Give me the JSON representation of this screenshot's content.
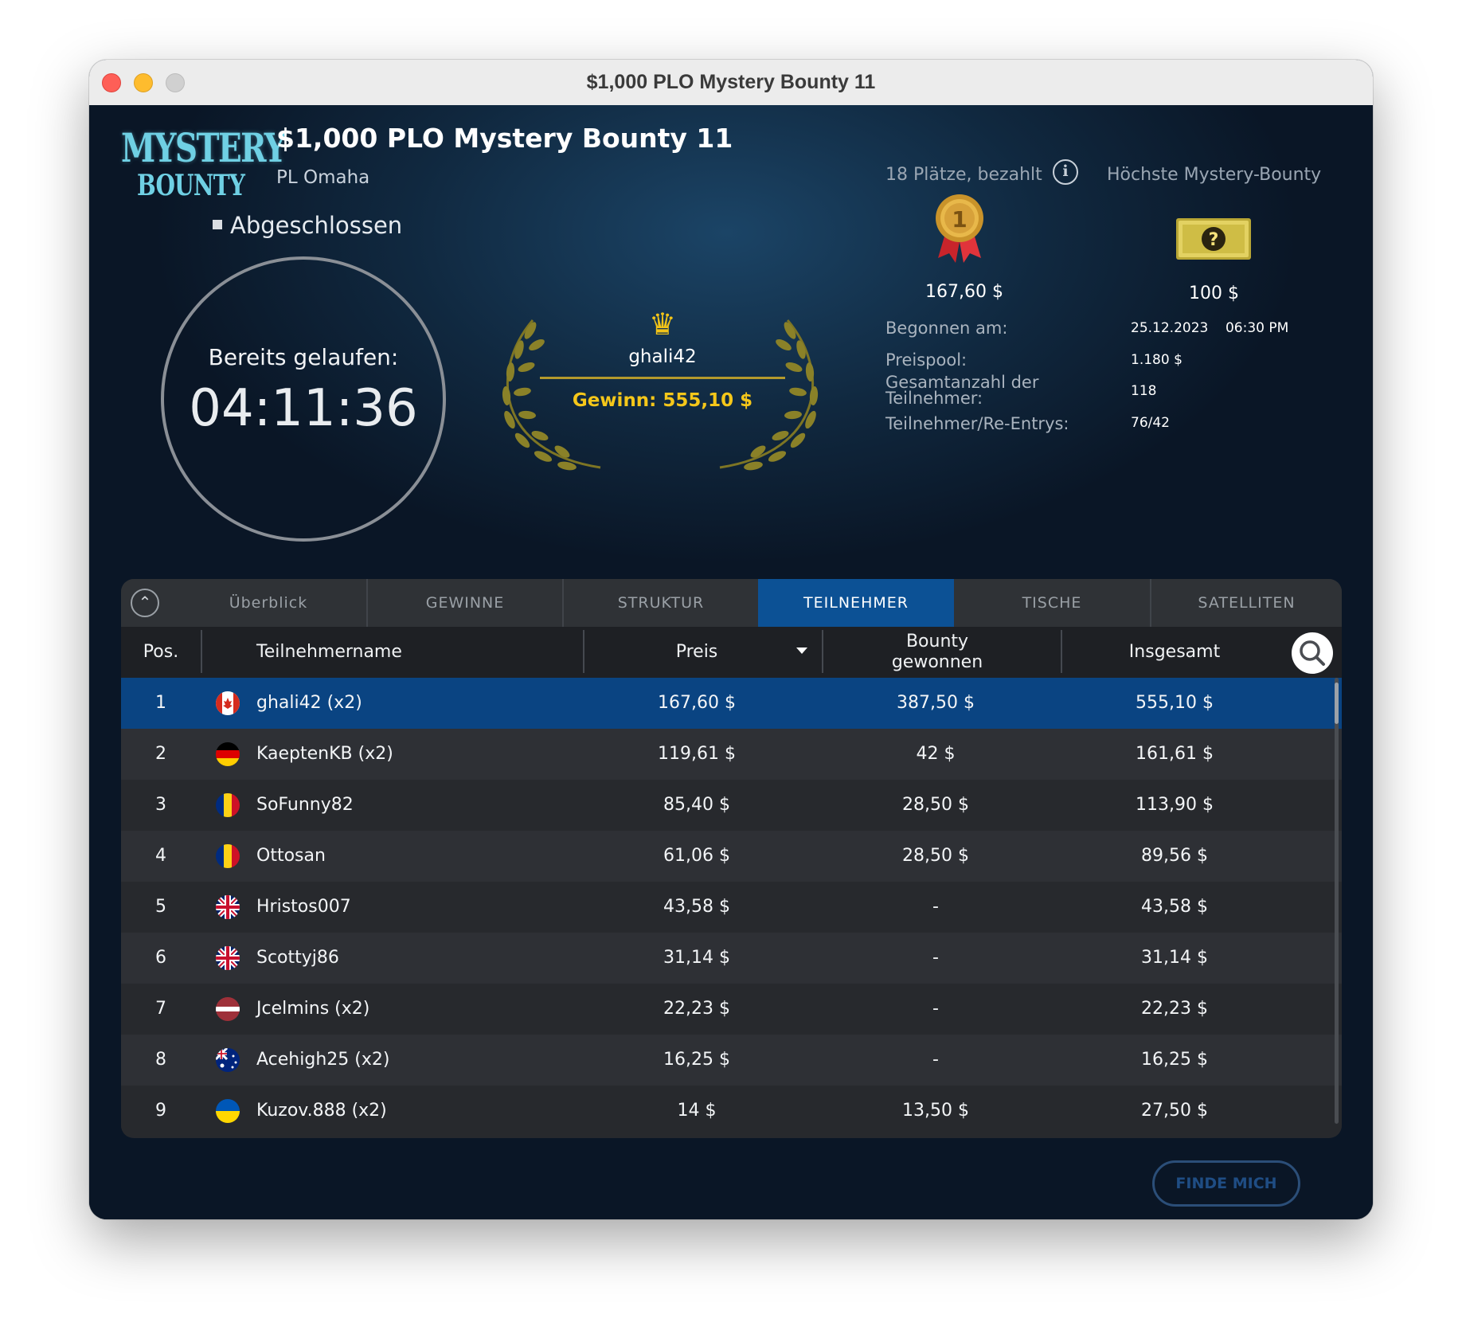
{
  "window": {
    "title": "$1,000 PLO Mystery Bounty 11"
  },
  "logo": {
    "line1": "MYSTERY",
    "line2": "BOUNTY"
  },
  "tournament": {
    "title": "$1,000 PLO Mystery Bounty 11",
    "game": "PL Omaha",
    "status": "Abgeschlossen"
  },
  "timer": {
    "label": "Bereits gelaufen:",
    "value": "04:11:36"
  },
  "winner": {
    "name": "ghali42",
    "gain": "Gewinn: 555,10 $"
  },
  "prizes": {
    "places_label": "18 Plätze, bezahlt",
    "bounty_label": "Höchste Mystery-Bounty",
    "first_prize": "167,60 $",
    "top_bounty": "100 $"
  },
  "details": {
    "started_label": "Begonnen am:",
    "started_date": "25.12.2023",
    "started_time": "06:30 PM",
    "pool_label": "Preispool:",
    "pool_value": "1.180 $",
    "total_label": "Gesamtanzahl der Teilnehmer:",
    "total_value": "118",
    "reentry_label": "Teilnehmer/Re-Entrys:",
    "reentry_value": "76/42"
  },
  "tabs": [
    "Überblick",
    "GEWINNE",
    "STRUKTUR",
    "TEILNEHMER",
    "TISCHE",
    "SATELLITEN"
  ],
  "active_tab": "TEILNEHMER",
  "table": {
    "headers": {
      "pos": "Pos.",
      "name": "Teilnehmername",
      "prize": "Preis",
      "bounty": "Bounty gewonnen",
      "total": "Insgesamt"
    },
    "rows": [
      {
        "pos": "1",
        "flag": "canada",
        "name": "ghali42 (x2)",
        "prize": "167,60 $",
        "bounty": "387,50 $",
        "total": "555,10 $"
      },
      {
        "pos": "2",
        "flag": "germany",
        "name": "KaeptenKB (x2)",
        "prize": "119,61 $",
        "bounty": "42 $",
        "total": "161,61 $"
      },
      {
        "pos": "3",
        "flag": "romania",
        "name": "SoFunny82",
        "prize": "85,40 $",
        "bounty": "28,50 $",
        "total": "113,90 $"
      },
      {
        "pos": "4",
        "flag": "romania",
        "name": "Ottosan",
        "prize": "61,06 $",
        "bounty": "28,50 $",
        "total": "89,56 $"
      },
      {
        "pos": "5",
        "flag": "uk",
        "name": "Hristos007",
        "prize": "43,58 $",
        "bounty": "-",
        "total": "43,58 $"
      },
      {
        "pos": "6",
        "flag": "uk",
        "name": "Scottyj86",
        "prize": "31,14 $",
        "bounty": "-",
        "total": "31,14 $"
      },
      {
        "pos": "7",
        "flag": "latvia",
        "name": "Jcelmins (x2)",
        "prize": "22,23 $",
        "bounty": "-",
        "total": "22,23 $"
      },
      {
        "pos": "8",
        "flag": "australia",
        "name": "Acehigh25 (x2)",
        "prize": "16,25 $",
        "bounty": "-",
        "total": "16,25 $"
      },
      {
        "pos": "9",
        "flag": "ukraine",
        "name": "Kuzov.888 (x2)",
        "prize": "14 $",
        "bounty": "13,50 $",
        "total": "27,50 $"
      }
    ]
  },
  "find_me": "FINDE MICH",
  "colors": {
    "accent": "#0c5195",
    "gold": "#f5c71a",
    "selected_row": "#0a4482"
  }
}
